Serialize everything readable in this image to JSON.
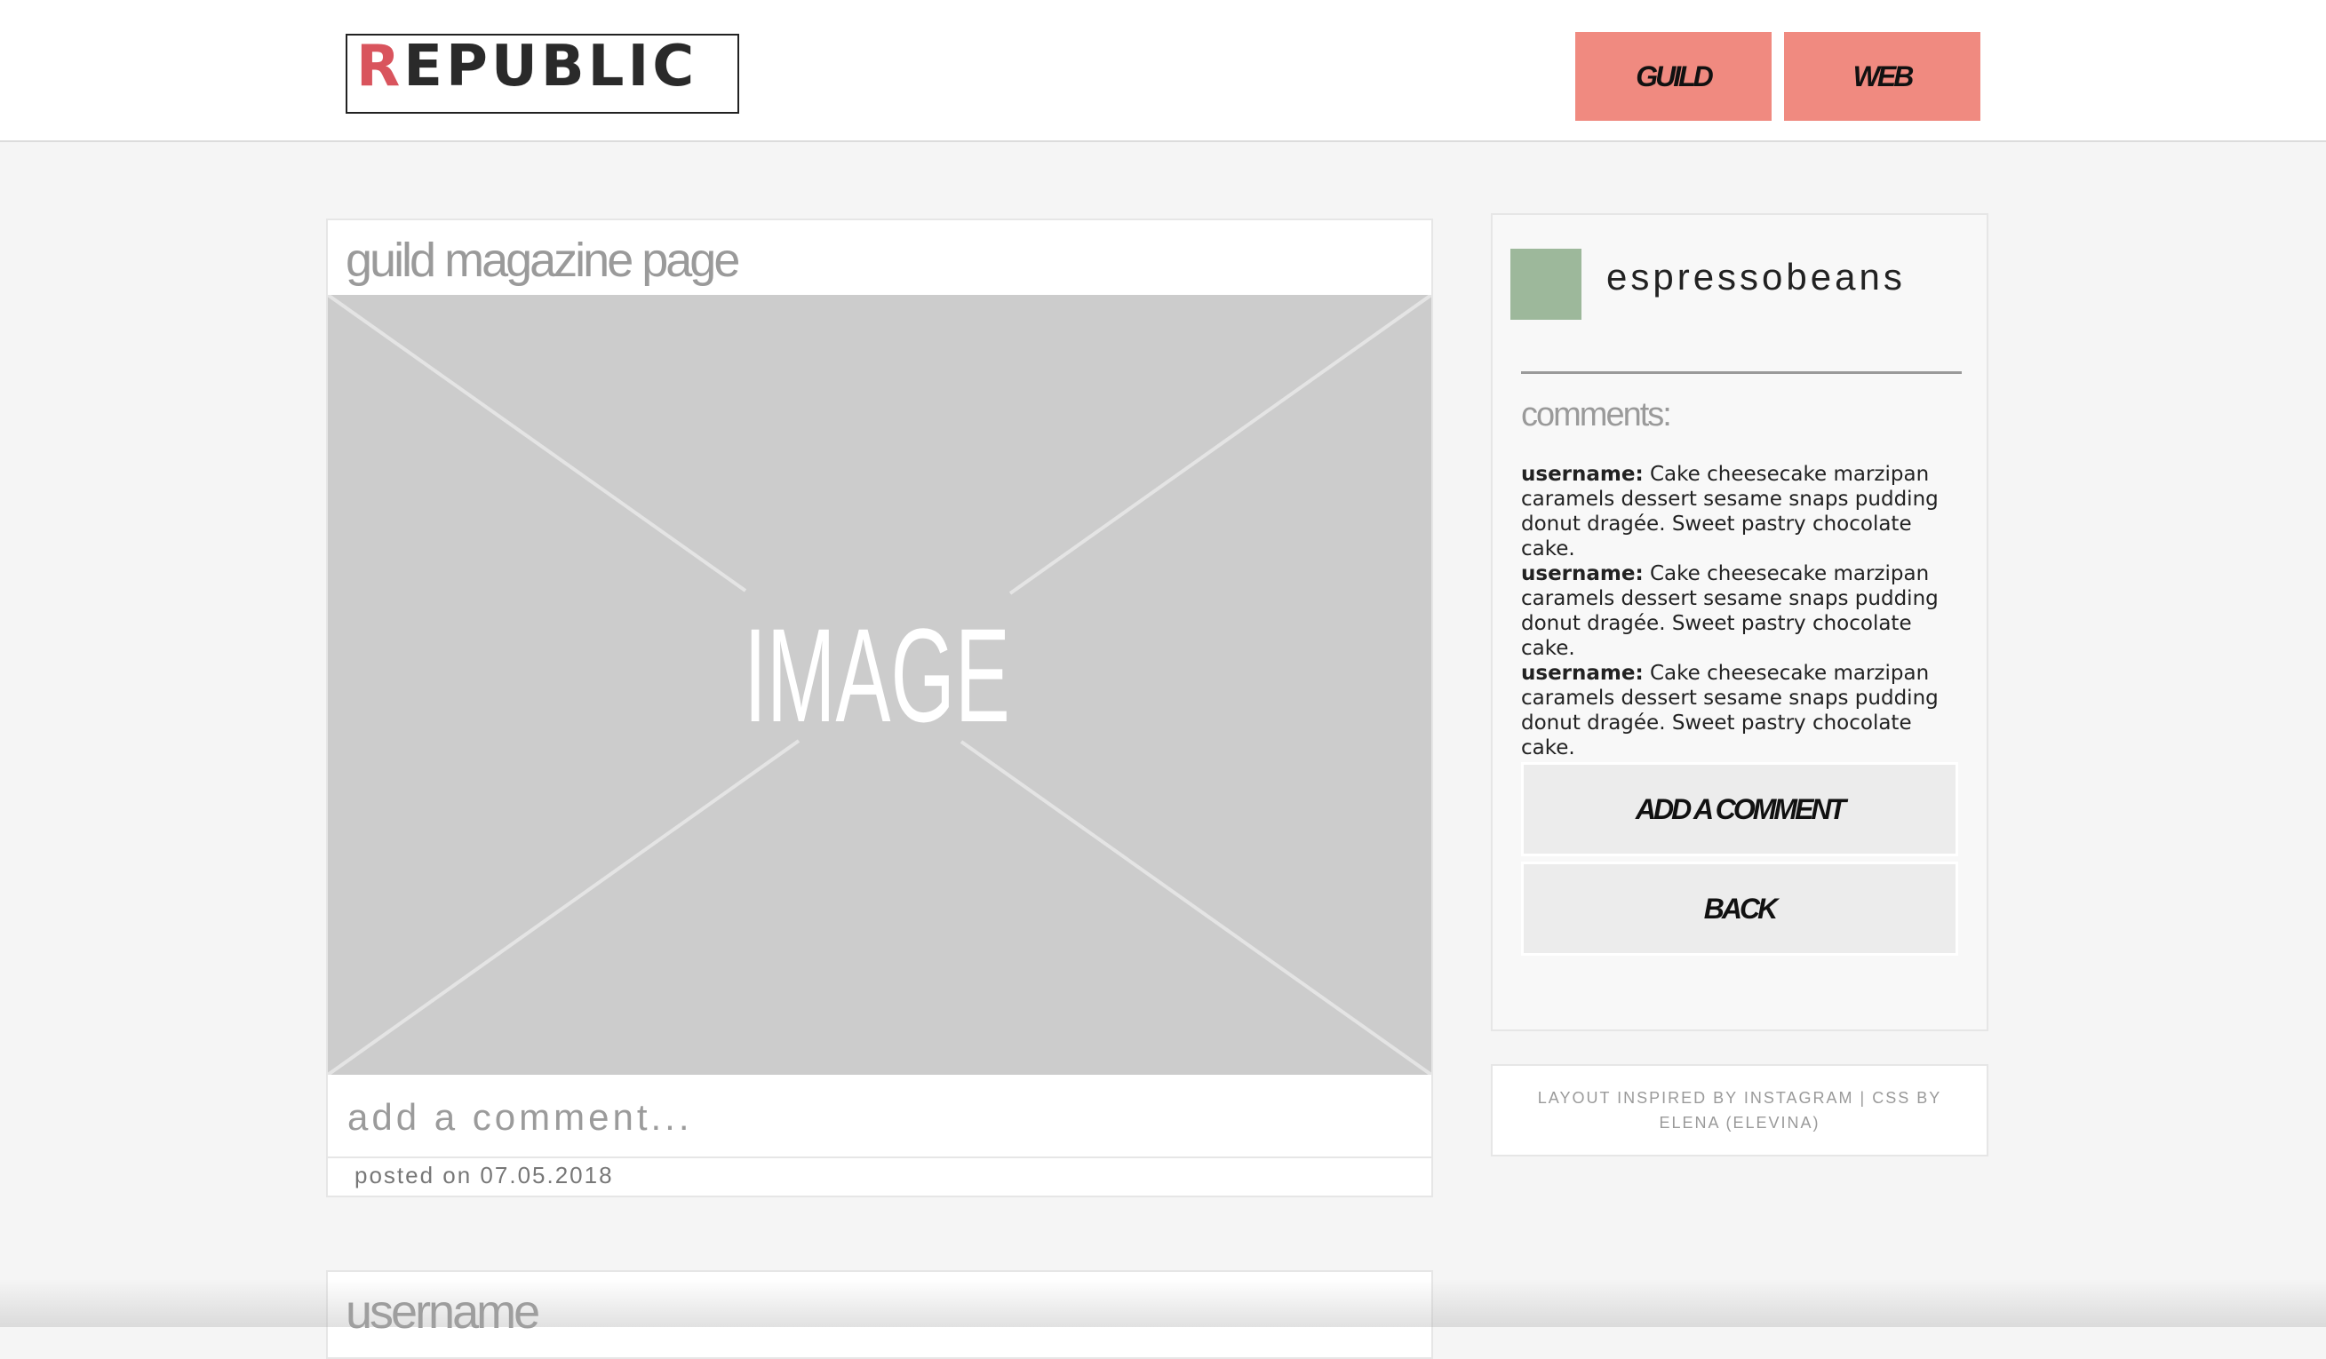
{
  "header": {
    "logo_first_letter": "R",
    "logo_rest": "EPUBLIC",
    "nav": [
      {
        "label": "GUILD"
      },
      {
        "label": "WEB"
      }
    ]
  },
  "post": {
    "title": "guild magazine page",
    "image_label": "IMAGE",
    "comment_placeholder": "add a comment...",
    "posted_on": "posted on 07.05.2018"
  },
  "next_post": {
    "title": "username"
  },
  "sidebar": {
    "profile_name": "espressobeans",
    "comments_heading": "comments:",
    "comments": [
      {
        "username": "username:",
        "text": " Cake cheesecake marzipan caramels dessert sesame snaps pudding donut dragée. Sweet pastry chocolate cake."
      },
      {
        "username": "username:",
        "text": " Cake cheesecake marzipan caramels dessert sesame snaps pudding donut dragée. Sweet pastry chocolate cake."
      },
      {
        "username": "username:",
        "text": " Cake cheesecake marzipan caramels dessert sesame snaps pudding donut dragée. Sweet pastry chocolate cake."
      }
    ],
    "add_comment_label": "ADD A COMMENT",
    "back_label": "BACK"
  },
  "footer": {
    "credit": "LAYOUT INSPIRED BY INSTAGRAM | CSS BY ELENA (ELEVINA)"
  },
  "colors": {
    "accent": "#f08a80",
    "logo_red": "#d9545d",
    "avatar": "#9db89b",
    "image_placeholder": "#cccccc"
  }
}
